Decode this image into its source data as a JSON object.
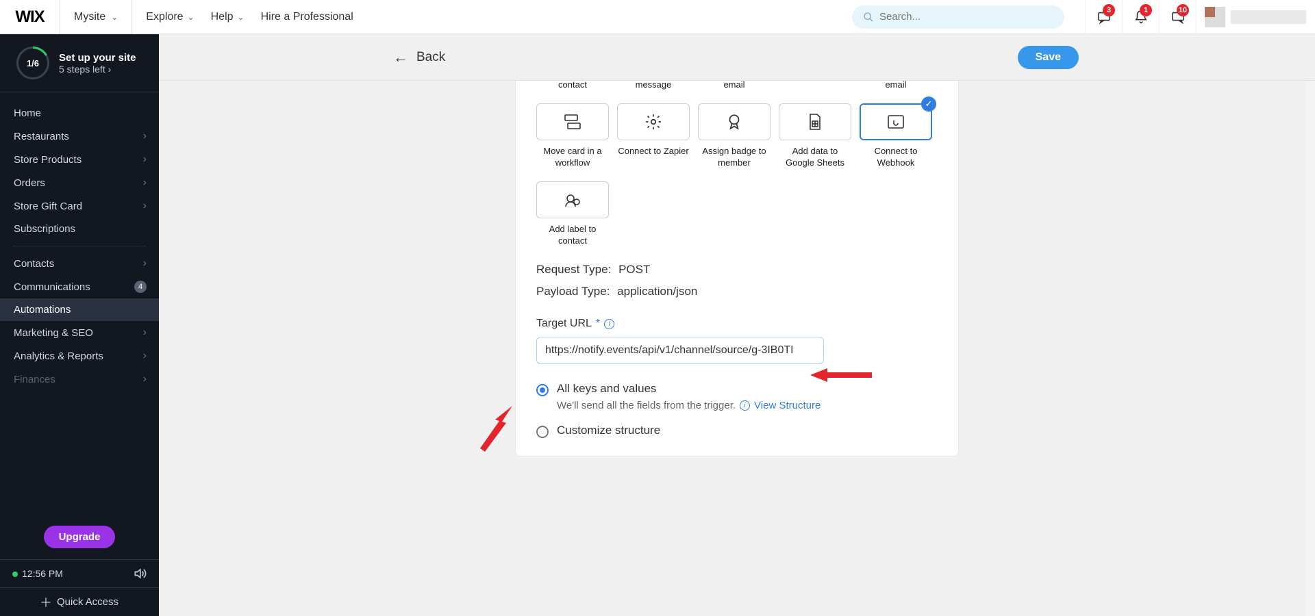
{
  "topbar": {
    "logo": "WIX",
    "site_label": "Mysite",
    "nav": {
      "explore": "Explore",
      "help": "Help",
      "hire": "Hire a Professional"
    },
    "search_placeholder": "Search...",
    "badges": {
      "chat": "3",
      "bell": "1",
      "inbox": "10"
    }
  },
  "setup": {
    "progress": "1/6",
    "title": "Set up your site",
    "sub": "5 steps left"
  },
  "sidebar": {
    "items": [
      {
        "label": "Home",
        "expandable": false
      },
      {
        "label": "Restaurants",
        "expandable": true
      },
      {
        "label": "Store Products",
        "expandable": true
      },
      {
        "label": "Orders",
        "expandable": true
      },
      {
        "label": "Store Gift Card",
        "expandable": true
      },
      {
        "label": "Subscriptions",
        "expandable": false
      }
    ],
    "items2": [
      {
        "label": "Contacts",
        "expandable": true
      },
      {
        "label": "Communications",
        "expandable": false,
        "count": "4"
      },
      {
        "label": "Automations",
        "active": true
      },
      {
        "label": "Marketing & SEO",
        "expandable": true
      },
      {
        "label": "Analytics & Reports",
        "expandable": true
      },
      {
        "label": "Finances",
        "expandable": true,
        "dim": true
      }
    ],
    "upgrade": "Upgrade",
    "time": "12:56 PM",
    "quick_access": "Quick Access"
  },
  "page": {
    "back": "Back",
    "save": "Save"
  },
  "cards": {
    "row0": [
      {
        "label": "contact"
      },
      {
        "label": "message"
      },
      {
        "label": "email"
      },
      {
        "label": ""
      },
      {
        "label": "email"
      }
    ],
    "row1": [
      {
        "label": "Move card in a workflow"
      },
      {
        "label": "Connect to Zapier"
      },
      {
        "label": "Assign badge to member"
      },
      {
        "label": "Add data to Google Sheets"
      },
      {
        "label": "Connect to Webhook",
        "selected": true
      }
    ],
    "row2": [
      {
        "label": "Add label to contact"
      }
    ]
  },
  "kv": {
    "request_key": "Request Type:",
    "request_val": "POST",
    "payload_key": "Payload Type:",
    "payload_val": "application/json"
  },
  "target": {
    "label": "Target URL",
    "value": "https://notify.events/api/v1/channel/source/g-3IB0TI"
  },
  "options": {
    "all_title": "All keys and values",
    "all_sub": "We'll send all the fields from the trigger.",
    "view_structure": "View Structure",
    "customize": "Customize structure"
  }
}
